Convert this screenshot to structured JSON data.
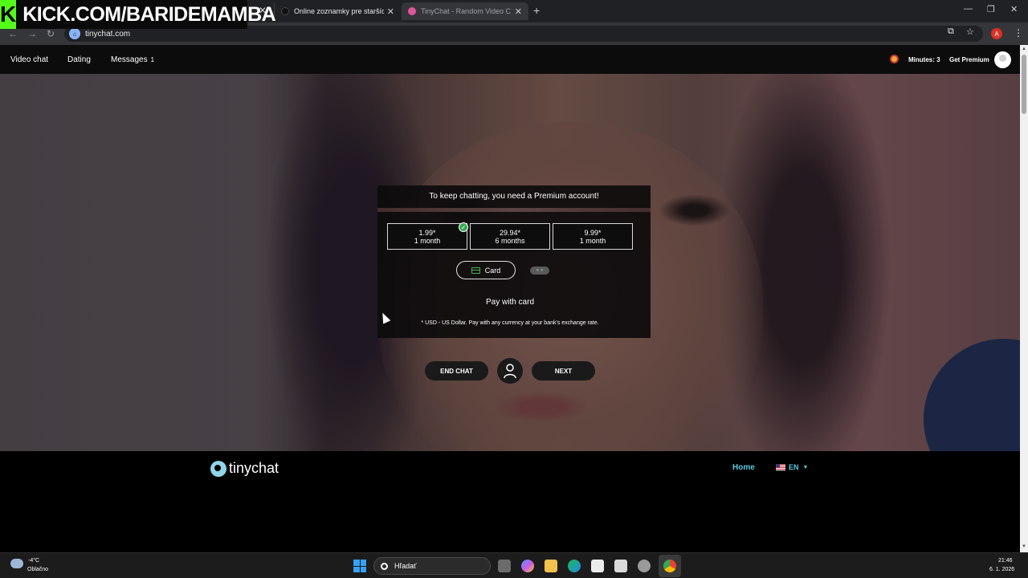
{
  "overlay": {
    "kick_text": "KICK.COM/BARIDEMAMBA",
    "kick_letter": "K"
  },
  "browser": {
    "tabs": [
      {
        "title": "Online zoznamky pre starších"
      },
      {
        "title": "TinyChat - Random Video C"
      }
    ],
    "url": "tinychat.com",
    "profile_initial": "A"
  },
  "nav": {
    "items": [
      "Video chat",
      "Dating",
      "Messages"
    ],
    "messages_badge": "1",
    "minutes": "Minutes: 3",
    "get_premium": "Get Premium"
  },
  "dialog": {
    "title": "To keep chatting, you need a Premium account!",
    "plans": [
      {
        "price": "1.99*",
        "period": "1 month",
        "selected": true
      },
      {
        "price": "29.94*",
        "period": "6 months",
        "selected": false
      },
      {
        "price": "9.99*",
        "period": "1 month",
        "selected": false
      }
    ],
    "card_label": "Card",
    "pay_with": "Pay with card",
    "note": "* USD - US Dollar. Pay with any currency at your bank's exchange rate."
  },
  "controls": {
    "end_chat": "END CHAT",
    "next": "NEXT"
  },
  "footer": {
    "logo": "tinychat",
    "home": "Home",
    "lang": "EN"
  },
  "taskbar": {
    "temp": "-4°C",
    "weather": "Oblačno",
    "search": "Hľadať",
    "time": "21:46",
    "date": "6. 1. 2026"
  },
  "colors": {
    "accent": "#5bc8dd",
    "kick_green": "#53fc18",
    "check_green": "#34a853"
  }
}
